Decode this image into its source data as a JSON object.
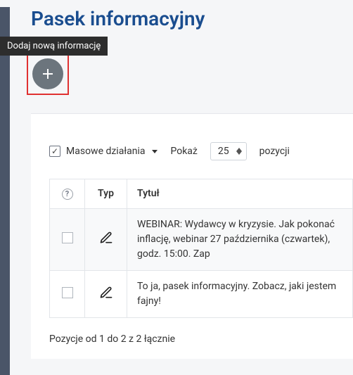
{
  "header": {
    "title": "Pasek informacyjny"
  },
  "tooltip": {
    "add": "Dodaj nową informację"
  },
  "toolbar": {
    "bulk_label": "Masowe działania",
    "show_label": "Pokaż",
    "show_value": "25",
    "show_suffix": "pozycji"
  },
  "table": {
    "columns": {
      "type": "Typ",
      "title": "Tytuł"
    },
    "rows": [
      {
        "title": "WEBINAR: Wydawcy w kryzysie. Jak pokonać inflację, webinar 27 października (czwartek), godz. 15:00. Zap"
      },
      {
        "title": "To ja, pasek informacyjny. Zobacz, jaki jestem fajny!"
      }
    ]
  },
  "footer": {
    "summary": "Pozycje od 1 do 2 z 2 łącznie"
  }
}
